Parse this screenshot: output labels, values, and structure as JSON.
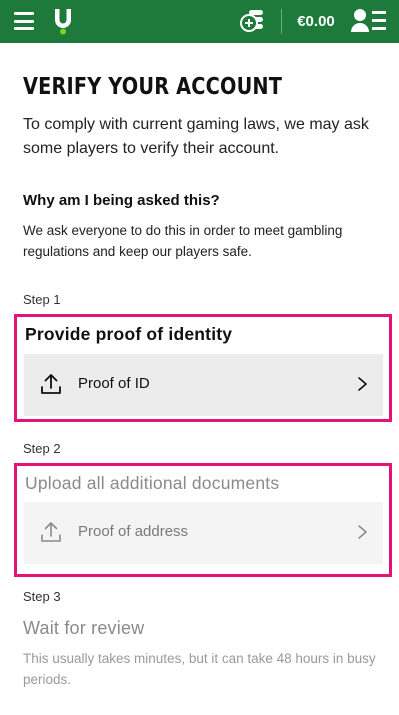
{
  "header": {
    "balance": "€0.00",
    "icons": [
      "menu-icon",
      "brand-logo",
      "bonus-icon",
      "account-icon"
    ],
    "colors": {
      "bar": "#1d7a3a",
      "accent_dot": "#7ed321"
    }
  },
  "main": {
    "title": "VERIFY YOUR ACCOUNT",
    "intro": "To comply with current gaming laws, we may ask some players to verify their account.",
    "why_heading": "Why am I being asked this?",
    "why_text": "We ask everyone to do this in order to meet gambling regulations and keep our players safe."
  },
  "steps": [
    {
      "label": "Step 1",
      "title": "Provide proof of identity",
      "document": "Proof of ID",
      "status": "active"
    },
    {
      "label": "Step 2",
      "title": "Upload all additional documents",
      "document": "Proof of address",
      "status": "inactive"
    },
    {
      "label": "Step 3",
      "title": "Wait for review",
      "description": "This usually takes minutes, but it can take 48 hours in busy periods.",
      "status": "inactive"
    }
  ],
  "highlight_color": "#e3137a"
}
